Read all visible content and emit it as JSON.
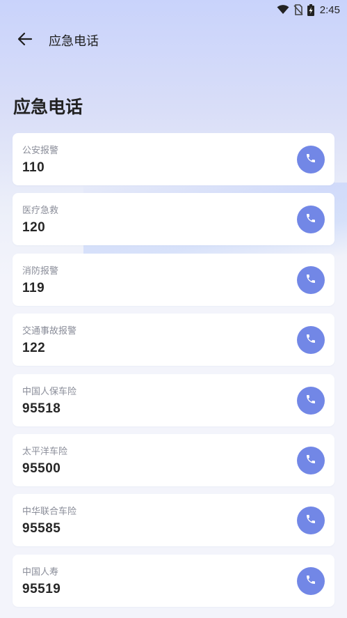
{
  "status_bar": {
    "time": "2:45",
    "icons": [
      "wifi-icon",
      "no-sim-icon",
      "battery-charging-icon"
    ]
  },
  "app_bar": {
    "back_icon": "arrow-left-icon",
    "title": "应急电话"
  },
  "page": {
    "heading": "应急电话"
  },
  "colors": {
    "accent": "#7287e6",
    "card_bg": "#ffffff",
    "label_text": "#8a8d99",
    "number_text": "#262626"
  },
  "contacts": [
    {
      "label": "公安报警",
      "number": "110",
      "icon": "phone-icon"
    },
    {
      "label": "医疗急救",
      "number": "120",
      "icon": "phone-icon"
    },
    {
      "label": "消防报警",
      "number": "119",
      "icon": "phone-icon"
    },
    {
      "label": "交通事故报警",
      "number": "122",
      "icon": "phone-icon"
    },
    {
      "label": "中国人保车险",
      "number": "95518",
      "icon": "phone-icon"
    },
    {
      "label": "太平洋车险",
      "number": "95500",
      "icon": "phone-icon"
    },
    {
      "label": "中华联合车险",
      "number": "95585",
      "icon": "phone-icon"
    },
    {
      "label": "中国人寿",
      "number": "95519",
      "icon": "phone-icon"
    }
  ]
}
